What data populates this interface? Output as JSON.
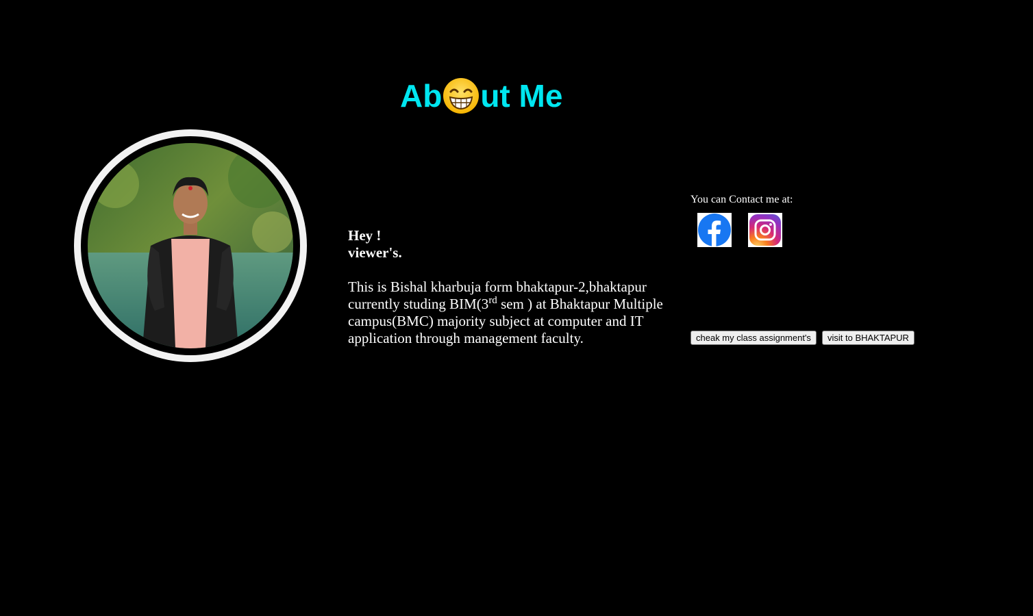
{
  "header": {
    "title_before": "Ab",
    "title_emoji": "grinning-face-icon",
    "title_after": "ut Me"
  },
  "intro": {
    "greeting_line1": "Hey !",
    "greeting_line2": "viewer's.",
    "bio_part1": "This is Bishal kharbuja form bhaktapur-2,bhaktapur currently studing BIM(3",
    "bio_sup": "rd",
    "bio_part2": " sem ) at Bhaktapur Multiple campus(BMC) majority subject at computer and IT application through management faculty."
  },
  "contact": {
    "label": "You can Contact me at:",
    "links": [
      {
        "icon": "facebook-icon"
      },
      {
        "icon": "instagram-icon"
      }
    ]
  },
  "actions": {
    "assignments_label": "cheak my class assignment's",
    "visit_label": "visit to BHAKTAPUR"
  },
  "colors": {
    "background": "#000000",
    "title": "#00e6f0",
    "text": "#ffffff",
    "facebook": "#1877f2"
  }
}
